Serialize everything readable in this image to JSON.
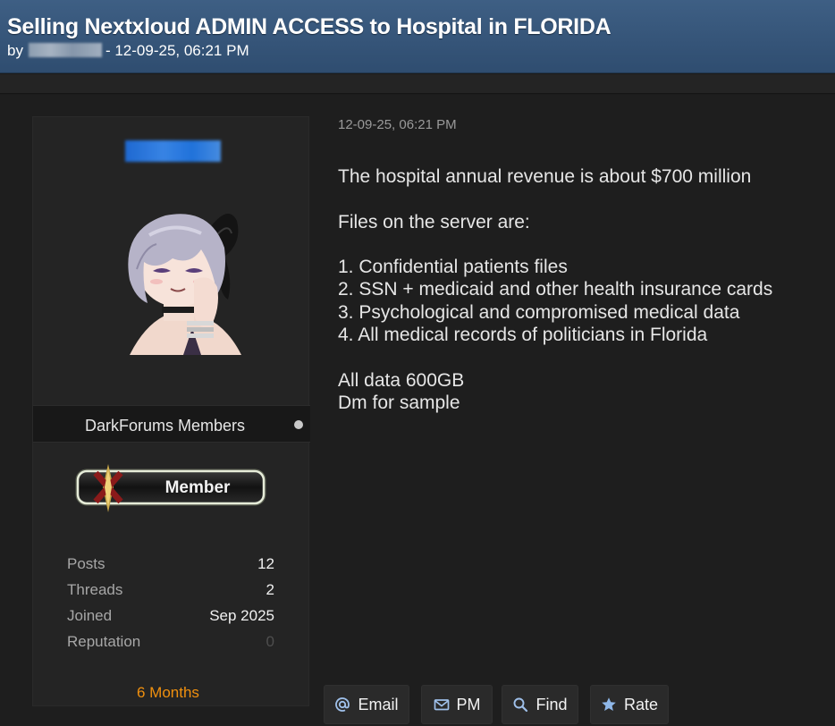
{
  "thread": {
    "title": "Selling Nextxloud ADMIN ACCESS to Hospital in FLORIDA",
    "by_label": "by",
    "date_time": "- 12-09-25, 06:21 PM"
  },
  "author": {
    "group": "DarkForums Members",
    "rank_badge": "Member",
    "stats": [
      {
        "label": "Posts",
        "value": "12"
      },
      {
        "label": "Threads",
        "value": "2"
      },
      {
        "label": "Joined",
        "value": "Sep 2025"
      },
      {
        "label": "Reputation",
        "value": "0"
      }
    ],
    "membership_duration": "6 Months"
  },
  "post": {
    "date": "12-09-25, 06:21 PM",
    "lines": [
      "The hospital annual revenue is about $700 million",
      "",
      "Files on the server are:",
      "",
      "1. Confidential patients files",
      "2. SSN + medicaid and other health insurance cards",
      "3. Psychological and compromised medical data",
      "4. All medical records of politicians in Florida",
      "",
      "All data 600GB",
      "Dm for sample"
    ]
  },
  "actions": {
    "email": {
      "label": "Email",
      "icon": "at-icon"
    },
    "pm": {
      "label": "PM",
      "icon": "envelope-icon"
    },
    "find": {
      "label": "Find",
      "icon": "search-icon"
    },
    "rate": {
      "label": "Rate",
      "icon": "star-icon"
    }
  },
  "colors": {
    "header_bg": "#3e5f84",
    "username_blur": "#2d7cf0",
    "months_accent": "#f0900e",
    "rate_star": "#8fb7e8"
  }
}
